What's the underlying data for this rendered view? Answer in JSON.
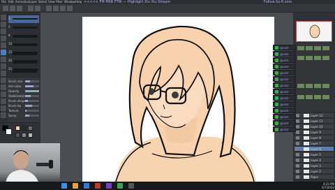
{
  "window": {
    "menu_items": [
      "File",
      "Edit",
      "Animation",
      "Layer",
      "Select",
      "View",
      "Filter",
      "Window",
      "Help"
    ],
    "stream_title": "<<<<< FM MSR FTRI — Highlight Xiu Xiu Stream",
    "stream_right": "Follow ko-fi.com"
  },
  "tool_panel": {
    "brush_sizes": [
      "3",
      "5",
      "8",
      "10",
      "15",
      "20",
      "25"
    ],
    "properties": [
      {
        "label": "Brush size",
        "value": 0.35
      },
      {
        "label": "Anti-alias",
        "value": 0.6
      },
      {
        "label": "Opacity",
        "value": 1.0
      },
      {
        "label": "Stabilization",
        "value": 0.4
      },
      {
        "label": "Brush shape",
        "value": 0.2
      },
      {
        "label": "Brush tip",
        "value": 0.5
      },
      {
        "label": "Texture",
        "value": 0.1
      },
      {
        "label": "Spray",
        "value": 0.3
      }
    ]
  },
  "colors": {
    "main": "#000000",
    "sub": "#ffffff",
    "skin": "#f7d4b0",
    "hair": "#f8d2ad",
    "accent": "#4b7fc1"
  },
  "stream_tags": [
    "@user",
    "@user",
    "@user",
    "@user",
    "@user",
    "@user",
    "@user",
    "@user",
    "@user",
    "@user",
    "@user",
    "@user",
    "@user",
    "@user"
  ],
  "layers": [
    "Layer 12",
    "Layer 11",
    "Layer 10",
    "Layer 9",
    "Layer 8",
    "Layer 7",
    "Layer 6",
    "Layer 5",
    "Layer 4",
    "Layer 3",
    "Layer 2",
    "Paper"
  ],
  "taskbar": {
    "time": "4:22 PM",
    "date": "6/7/2020"
  }
}
